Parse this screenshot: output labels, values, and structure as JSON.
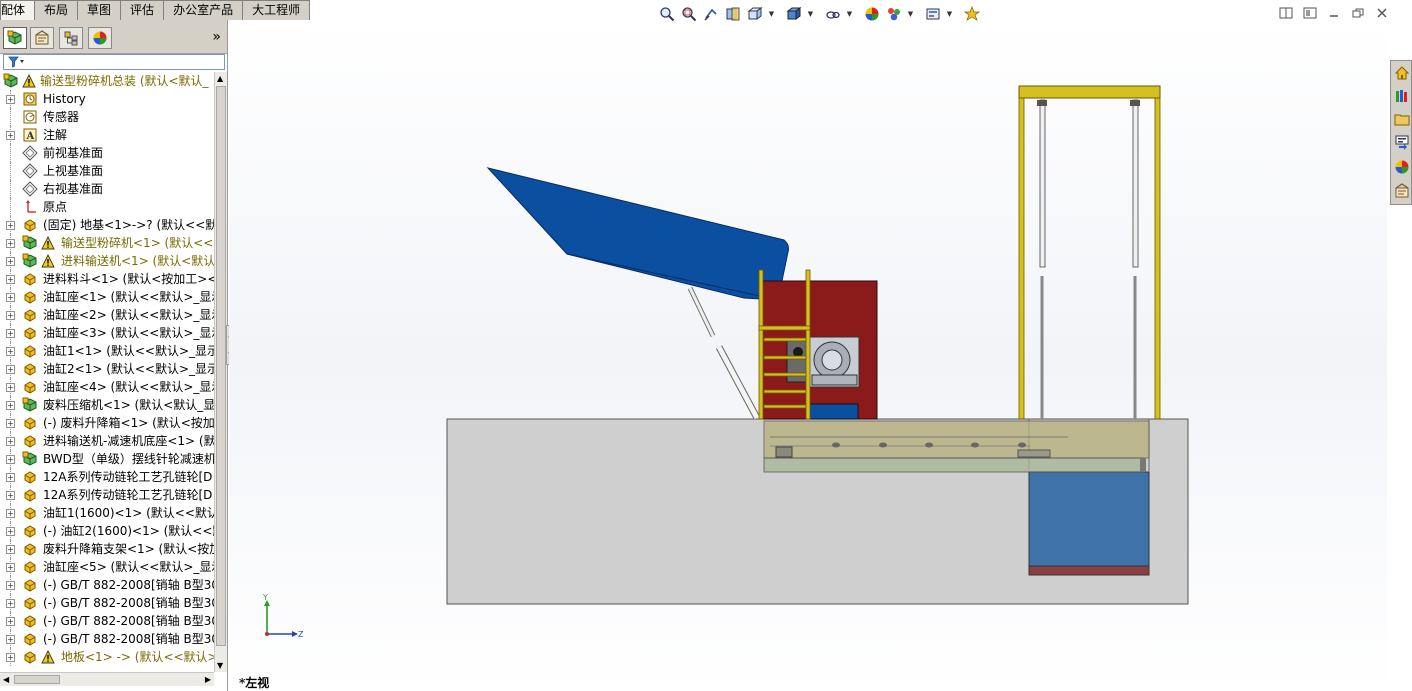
{
  "command_tabs": [
    {
      "label": "配体",
      "active": true
    },
    {
      "label": "布局",
      "active": false
    },
    {
      "label": "草图",
      "active": false
    },
    {
      "label": "评估",
      "active": false
    },
    {
      "label": "办公室产品",
      "active": false
    },
    {
      "label": "大工程师",
      "active": false
    }
  ],
  "hud_toolbar": [
    {
      "icon": "zoom-to-fit-icon"
    },
    {
      "icon": "zoom-to-area-icon"
    },
    {
      "icon": "previous-view-icon"
    },
    {
      "icon": "section-view-icon"
    },
    {
      "icon": "view-orientation-icon",
      "dropdown": true
    },
    {
      "icon": "display-style-icon",
      "dropdown": true
    },
    {
      "icon": "hide-show-items-icon",
      "dropdown": true
    },
    {
      "icon": "edit-appearance-icon"
    },
    {
      "icon": "apply-scene-icon",
      "dropdown": true
    },
    {
      "icon": "view-settings-icon",
      "dropdown": true
    },
    {
      "icon": "rendering-tools-icon"
    }
  ],
  "panel_tabs": [
    {
      "icon": "feature-manager-icon",
      "active": true
    },
    {
      "icon": "property-manager-icon",
      "active": false
    },
    {
      "icon": "configuration-manager-icon",
      "active": false
    },
    {
      "icon": "display-manager-icon",
      "active": false
    }
  ],
  "panel_expand": "»",
  "tree": [
    {
      "label": "输送型粉碎机总装  (默认<默认_",
      "type": "assembly-warn",
      "expand": false,
      "indent": 0
    },
    {
      "label": "History",
      "type": "history",
      "expand": true,
      "indent": 1
    },
    {
      "label": "传感器",
      "type": "sensor",
      "expand": false,
      "indent": 1
    },
    {
      "label": "注解",
      "type": "annotation",
      "expand": true,
      "indent": 1
    },
    {
      "label": "前视基准面",
      "type": "plane",
      "expand": false,
      "indent": 1
    },
    {
      "label": "上视基准面",
      "type": "plane",
      "expand": false,
      "indent": 1
    },
    {
      "label": "右视基准面",
      "type": "plane",
      "expand": false,
      "indent": 1
    },
    {
      "label": "原点",
      "type": "origin",
      "expand": false,
      "indent": 1
    },
    {
      "label": "(固定) 地基<1>->? (默认<<默",
      "type": "part",
      "expand": true,
      "indent": 1
    },
    {
      "label": "输送型粉碎机<1> (默认<<默",
      "type": "subasm-warn",
      "expand": true,
      "indent": 1
    },
    {
      "label": "进料输送机<1> (默认<默认_",
      "type": "subasm-warn",
      "expand": true,
      "indent": 1
    },
    {
      "label": "进料料斗<1> (默认<按加工><",
      "type": "part",
      "expand": true,
      "indent": 1
    },
    {
      "label": "油缸座<1> (默认<<默认>_显示",
      "type": "part",
      "expand": true,
      "indent": 1
    },
    {
      "label": "油缸座<2> (默认<<默认>_显示",
      "type": "part",
      "expand": true,
      "indent": 1
    },
    {
      "label": "油缸座<3> (默认<<默认>_显示",
      "type": "part",
      "expand": true,
      "indent": 1
    },
    {
      "label": "油缸1<1> (默认<<默认>_显示",
      "type": "part",
      "expand": true,
      "indent": 1
    },
    {
      "label": "油缸2<1> (默认<<默认>_显示",
      "type": "part",
      "expand": true,
      "indent": 1
    },
    {
      "label": "油缸座<4> (默认<<默认>_显示",
      "type": "part",
      "expand": true,
      "indent": 1
    },
    {
      "label": "废料压缩机<1> (默认<默认_显",
      "type": "subasm",
      "expand": true,
      "indent": 1
    },
    {
      "label": "(-) 废料升降箱<1> (默认<按加",
      "type": "part",
      "expand": true,
      "indent": 1
    },
    {
      "label": "进料输送机-减速机底座<1> (默",
      "type": "part",
      "expand": true,
      "indent": 1
    },
    {
      "label": "BWD型（单级）摆线针轮减速机",
      "type": "subasm",
      "expand": true,
      "indent": 1
    },
    {
      "label": "12A系列传动链轮工艺孔链轮[D",
      "type": "part",
      "expand": true,
      "indent": 1
    },
    {
      "label": "12A系列传动链轮工艺孔链轮[D",
      "type": "part",
      "expand": true,
      "indent": 1
    },
    {
      "label": "油缸1(1600)<1> (默认<<默认",
      "type": "part",
      "expand": true,
      "indent": 1
    },
    {
      "label": "(-) 油缸2(1600)<1> (默认<<默",
      "type": "part",
      "expand": true,
      "indent": 1
    },
    {
      "label": "废料升降箱支架<1> (默认<按加",
      "type": "part",
      "expand": true,
      "indent": 1
    },
    {
      "label": "油缸座<5> (默认<<默认>_显示",
      "type": "part",
      "expand": true,
      "indent": 1
    },
    {
      "label": "(-) GB/T 882-2008[销轴 B型30",
      "type": "part",
      "expand": true,
      "indent": 1
    },
    {
      "label": "(-) GB/T 882-2008[销轴 B型30",
      "type": "part",
      "expand": true,
      "indent": 1
    },
    {
      "label": "(-) GB/T 882-2008[销轴 B型30",
      "type": "part",
      "expand": true,
      "indent": 1
    },
    {
      "label": "(-) GB/T 882-2008[销轴 B型30",
      "type": "part",
      "expand": true,
      "indent": 1
    },
    {
      "label": "地板<1> -> (默认<<默认>_",
      "type": "part-warn",
      "expand": true,
      "indent": 1
    }
  ],
  "view": {
    "label": "*左视",
    "triad": {
      "y": "Y",
      "z": "Z"
    }
  },
  "task_pane": [
    {
      "icon": "home-icon"
    },
    {
      "icon": "design-library-icon"
    },
    {
      "icon": "file-explorer-icon"
    },
    {
      "icon": "view-palette-icon"
    },
    {
      "icon": "appearances-icon"
    },
    {
      "icon": "custom-properties-icon"
    }
  ],
  "colors": {
    "hopper": "#0b4fa0",
    "frame_red": "#8b1a1a",
    "tower_yellow": "#d6c020",
    "foundation": "#cfcfcf",
    "pit_water": "#3f72a8",
    "conveyor_olive": "#a8a880"
  }
}
